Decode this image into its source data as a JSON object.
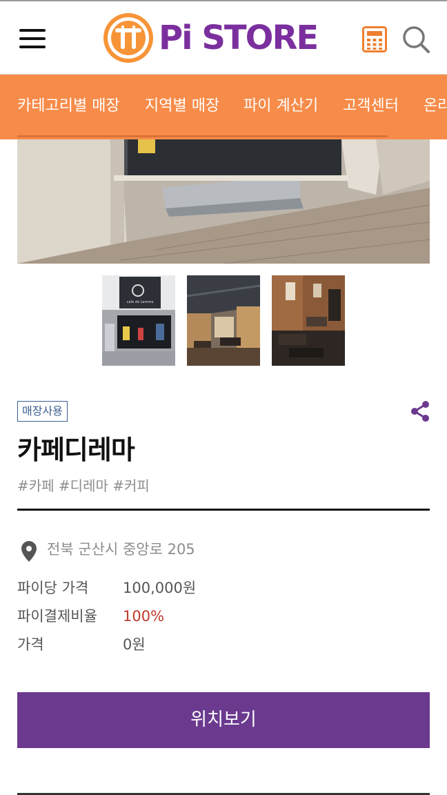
{
  "header": {
    "logo_text": "Pi STORE",
    "icons": [
      "menu-icon",
      "pi-logo-icon",
      "calculator-icon",
      "search-icon"
    ]
  },
  "nav": {
    "items": [
      "카테고리별 매장",
      "지역별 매장",
      "파이 계산기",
      "고객센터",
      "온라"
    ]
  },
  "store": {
    "badge": "매장사용",
    "name": "카페디레마",
    "tags": "#카페 #디레마 #커피",
    "address": "전북 군산시 중앙로 205",
    "details": [
      {
        "label": "파이당 가격",
        "value": "100,000원"
      },
      {
        "label": "파이결제비율",
        "value": "100%"
      },
      {
        "label": "가격",
        "value": "0원"
      }
    ],
    "location_button": "위치보기",
    "thumbnail_sign_text": "cafe de Lemma"
  },
  "colors": {
    "accent_orange": "#f78c4a",
    "brand_purple": "#7b2f9e",
    "button_purple": "#6b3a8f",
    "ratio_red": "#c0392b",
    "badge_blue": "#3a5d8f"
  }
}
